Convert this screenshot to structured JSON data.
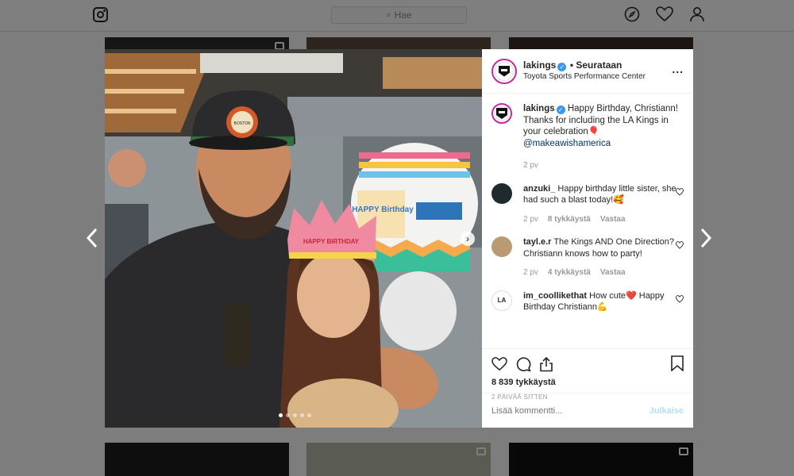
{
  "nav": {
    "search_placeholder": "Hae",
    "icons": [
      "instagram-logo",
      "search-icon",
      "compass-icon",
      "heart-icon",
      "user-icon"
    ]
  },
  "post": {
    "header": {
      "username": "lakings",
      "follow_status": "Seurataan",
      "location": "Toyota Sports Performance Center",
      "more": "..."
    },
    "caption": {
      "username": "lakings",
      "text": "Happy Birthday, Christiann! Thanks for including the LA Kings in your celebration",
      "emoji": "🎈",
      "mention": "@makeawishamerica",
      "time": "2 pv"
    },
    "comments": [
      {
        "username": "anzuki_",
        "text": "Happy birthday little sister, she had such a blast today!🥰",
        "time": "2 pv",
        "likes": "8 tykkäystä",
        "reply": "Vastaa"
      },
      {
        "username": "tayl.e.r",
        "text": "The Kings AND One Direction? Christiann knows how to party!",
        "time": "2 pv",
        "likes": "4 tykkäystä",
        "reply": "Vastaa"
      },
      {
        "username": "im_coollikethat",
        "text": "How cute❤️ Happy Birthday Christiann💪"
      }
    ],
    "likes_count": "8 839 tykkäystä",
    "posted": "2 PÄIVÄÄ SITTEN",
    "add_comment_placeholder": "Lisää kommentti...",
    "publish_label": "Julkaise",
    "photo_text": {
      "cap_patch": "BOSTON",
      "crown": "HAPPY BIRTHDAY",
      "balloon": "HAPPY Birthday"
    },
    "carousel": {
      "count": 5,
      "active": 0
    }
  },
  "colors": {
    "accent": "#3897f0",
    "story_ring": "#c32aa3",
    "publish_disabled": "#b2dffc",
    "heart_red": "#ed4956"
  }
}
